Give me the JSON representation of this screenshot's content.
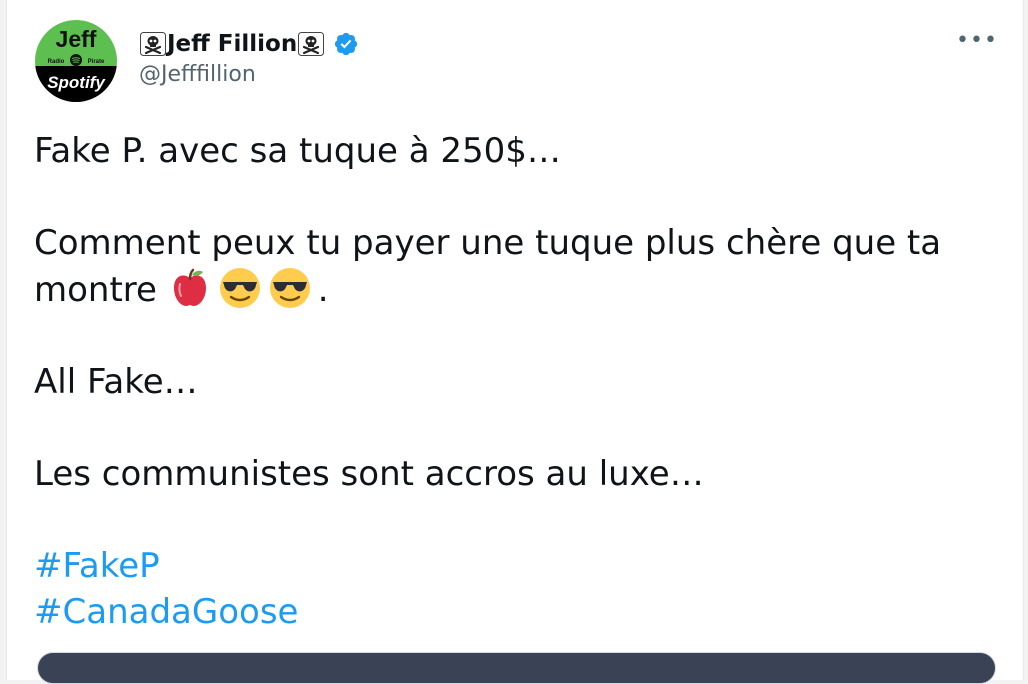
{
  "tweet": {
    "author": {
      "display_name": "Jeff Fillion",
      "name_decoration": "skull-and-crossbones-icon",
      "verified": true,
      "handle": "@Jefffillion",
      "avatar": {
        "title": "Jeff",
        "subtitle_left": "Radio",
        "subtitle_right": "Pirate",
        "brand": "Spotify",
        "colors": {
          "top": "#5cbf4f",
          "bottom": "#000000",
          "title": "#111111",
          "brand": "#ffffff"
        }
      }
    },
    "more_label": "•••",
    "text": {
      "line1": "Fake P. avec sa tuque à 250$…",
      "line2": "Comment peux tu payer une tuque plus chère que ta montre",
      "line2_emojis": [
        "red-apple-icon",
        "sunglasses-face-icon",
        "sunglasses-face-icon"
      ],
      "line2_end": ".",
      "line3": "All Fake…",
      "line4": "Les communistes sont accros au luxe…"
    },
    "hashtags": [
      "#FakeP",
      "#CanadaGoose"
    ],
    "colors": {
      "text": "#0f1419",
      "secondary": "#536471",
      "link": "#1d9bf0",
      "verified": "#1d9bf0"
    }
  }
}
